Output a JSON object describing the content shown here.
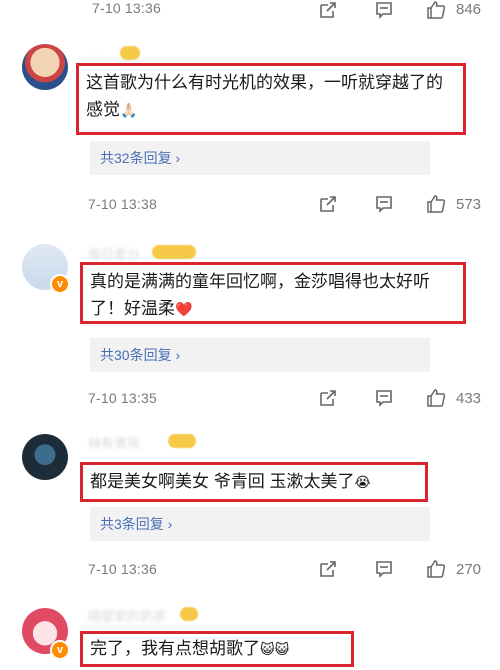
{
  "comments": [
    {
      "time": "7-10 13:36",
      "likes": "846"
    },
    {
      "author": "···",
      "text": "这首歌为什么有时光机的效果，一听就穿越了的感觉",
      "emoji": "🙏🏻",
      "replies": "共32条回复",
      "time": "7-10 13:38",
      "likes": "573"
    },
    {
      "author": "每日爱分",
      "text": "真的是满满的童年回忆啊，金莎唱得也太好听了！好温柔",
      "emoji": "❤️",
      "replies": "共30条回复",
      "time": "7-10 13:35",
      "likes": "433"
    },
    {
      "author": "林有青风",
      "text": "都是美女啊美女 爷青回 玉漱太美了",
      "emoji": "😭",
      "replies": "共3条回复",
      "time": "7-10 13:36",
      "likes": "270"
    },
    {
      "author": "隔壁家的奶茶",
      "text": "完了，我有点想胡歌了",
      "emoji": "😺😺"
    }
  ],
  "icons": {
    "share": "share-icon",
    "comment": "comment-icon",
    "like": "thumbs-up-icon",
    "chevron": "chevron-right-icon",
    "verified": "verified-badge"
  },
  "colors": {
    "highlight": "#d9252d",
    "link": "#4a6fb5",
    "meta": "#7a7a7a"
  }
}
